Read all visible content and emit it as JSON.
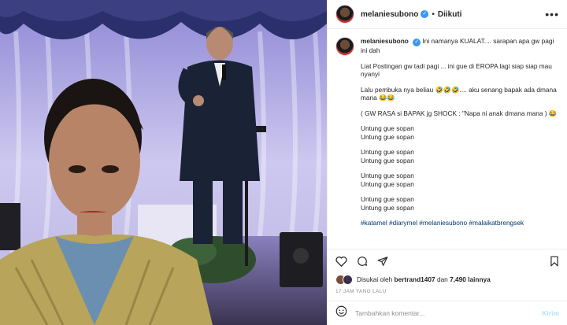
{
  "post": {
    "username": "melaniesubono",
    "verified_icon": "verified-badge-icon",
    "separator": "•",
    "follow_status": "Diikuti",
    "more_icon": "more-horizontal-icon",
    "caption": {
      "author": "melaniesubono",
      "lines": [
        "Ini namanya KUALAT.... sarapan apa gw pagi ini dah",
        "Liat Postingan gw tadi pagi ... ini gue di EROPA lagi siap siap mau nyanyi",
        "Lalu pembuka nya beliau 🤣🤣🤣.... aku senang bapak ada dmana mana 😂😂",
        "( GW RASA si BAPAK jg SHOCK : \"Napa ni anak dmana mana ) 😂",
        "Untung gue sopan\nUntung gue sopan",
        "Untung gue sopan\nUntung gue sopan",
        "Untung gue sopan\nUntung gue sopan",
        "Untung gue sopan\nUntung gue sopan"
      ],
      "hashtags": "#katamel #diarymel #melaniesubono #malaikatbrengsek"
    },
    "likes": {
      "prefix": "Disukai oleh",
      "user": "bertrand1407",
      "joiner": "dan",
      "count": "7,490 lainnya"
    },
    "timestamp": "17 JAM YANG LALU",
    "comment": {
      "placeholder": "Tambahkan komentar...",
      "send_label": "Kirim"
    }
  }
}
